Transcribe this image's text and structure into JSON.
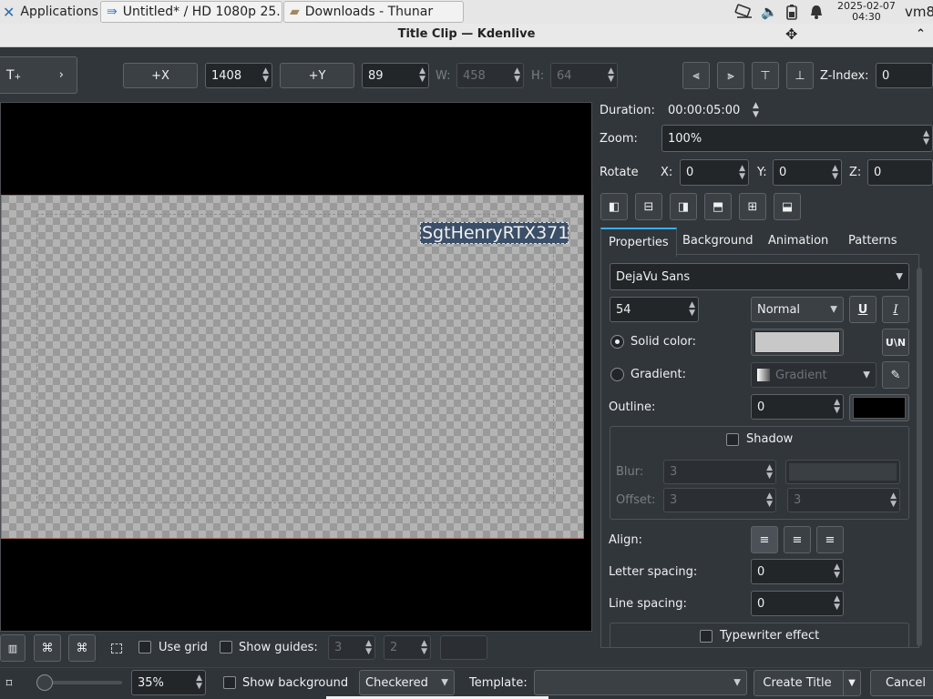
{
  "taskbar": {
    "applications": "Applications",
    "task1": "Untitled* / HD 1080p 25...",
    "task2": "Downloads - Thunar",
    "date": "2025-02-07",
    "time": "04:30",
    "user": "vm8"
  },
  "window": {
    "title": "Title Clip — Kdenlive"
  },
  "toolbar": {
    "plus_x": "+X",
    "x_value": "1408",
    "plus_y": "+Y",
    "y_value": "89",
    "w_label": "W:",
    "w_value": "458",
    "h_label": "H:",
    "h_value": "64",
    "z_index_label": "Z-Index:",
    "z_index_value": "0"
  },
  "canvas": {
    "text_item": "SgtHenryRTX371"
  },
  "right": {
    "duration_label": "Duration:",
    "duration_value": "00:00:05:00",
    "zoom_label": "Zoom:",
    "zoom_value": "100%",
    "rotate_label": "Rotate",
    "x_label": "X:",
    "x_value": "0",
    "y_label": "Y:",
    "y_value": "0",
    "z_label": "Z:",
    "z_value": "0",
    "tabs": [
      "Properties",
      "Background",
      "Animation",
      "Patterns"
    ],
    "font_family": "DejaVu Sans",
    "font_size": "54",
    "font_weight": "Normal",
    "solid_color": "Solid color:",
    "gradient_label": "Gradient:",
    "gradient_value": "Gradient",
    "outline_label": "Outline:",
    "outline_value": "0",
    "shadow": "Shadow",
    "blur_label": "Blur:",
    "blur_value": "3",
    "offset_label": "Offset:",
    "offset_x": "3",
    "offset_y": "3",
    "align_label": "Align:",
    "letter_spacing_label": "Letter spacing:",
    "letter_spacing_value": "0",
    "line_spacing_label": "Line spacing:",
    "line_spacing_value": "0",
    "typewriter": "Typewriter effect"
  },
  "bottom": {
    "use_grid": "Use grid",
    "show_guides": "Show guides:",
    "guides_a": "3",
    "guides_b": "2",
    "zoom_value": "35%",
    "show_background": "Show background",
    "background_mode": "Checkered",
    "template_label": "Template:",
    "create_title": "Create Title",
    "cancel": "Cancel"
  },
  "colors": {
    "accent": "#3daee9",
    "solid_color_swatch": "#c8c8c8",
    "outline_swatch": "#000000"
  }
}
